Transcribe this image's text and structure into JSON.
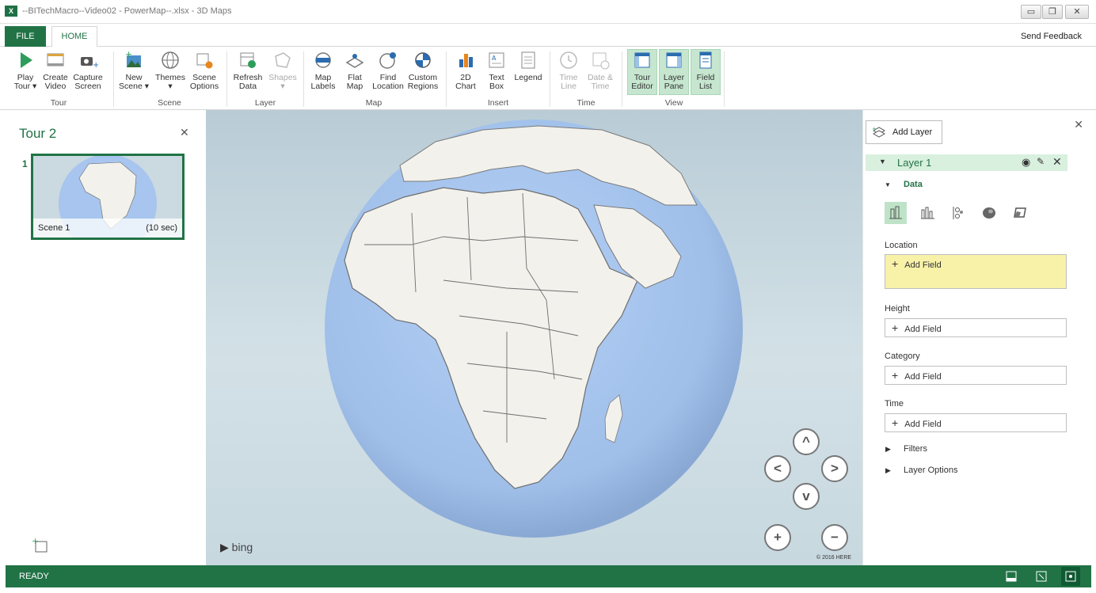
{
  "window": {
    "title": "--BITechMacro--Video02 - PowerMap--.xlsx - 3D Maps",
    "excel_badge": "X"
  },
  "tabs": {
    "file": "FILE",
    "home": "HOME",
    "send_feedback": "Send Feedback"
  },
  "ribbon": {
    "tour": {
      "play": "Play",
      "play2": "Tour ▾",
      "create": "Create",
      "create2": "Video",
      "capture": "Capture",
      "capture2": "Screen",
      "group": "Tour"
    },
    "scene": {
      "new": "New",
      "new2": "Scene ▾",
      "themes": "Themes",
      "themes2": "▾",
      "options": "Scene",
      "options2": "Options",
      "group": "Scene"
    },
    "layer": {
      "refresh": "Refresh",
      "refresh2": "Data",
      "shapes": "Shapes",
      "shapes2": "▾",
      "group": "Layer"
    },
    "map": {
      "labels": "Map",
      "labels2": "Labels",
      "flat": "Flat",
      "flat2": "Map",
      "find": "Find",
      "find2": "Location",
      "custom": "Custom",
      "custom2": "Regions",
      "group": "Map"
    },
    "insert": {
      "chart": "2D",
      "chart2": "Chart",
      "textbox": "Text",
      "textbox2": "Box",
      "legend": "Legend",
      "group": "Insert"
    },
    "time": {
      "timeline": "Time",
      "timeline2": "Line",
      "datetime": "Date &",
      "datetime2": "Time",
      "group": "Time"
    },
    "view": {
      "tour_editor": "Tour",
      "tour_editor2": "Editor",
      "layer_pane": "Layer",
      "layer_pane2": "Pane",
      "field_list": "Field",
      "field_list2": "List",
      "group": "View"
    }
  },
  "tour_pane": {
    "title": "Tour 2",
    "close": "✕",
    "scene_number": "1",
    "scene_name": "Scene 1",
    "scene_duration": "(10 sec)"
  },
  "map": {
    "bing": "bing",
    "copyright": "© 2016 HERE",
    "nav_up": "^",
    "nav_left": "<",
    "nav_right": ">",
    "nav_down": "v",
    "zoom_in": "+",
    "zoom_out": "−"
  },
  "layer_pane": {
    "close": "✕",
    "add_layer": "Add Layer",
    "layer_name": "Layer 1",
    "data_heading": "Data",
    "location_label": "Location",
    "height_label": "Height",
    "category_label": "Category",
    "time_label": "Time",
    "add_field": "Add Field",
    "filters": "Filters",
    "layer_options": "Layer Options"
  },
  "status": {
    "text": "READY"
  }
}
